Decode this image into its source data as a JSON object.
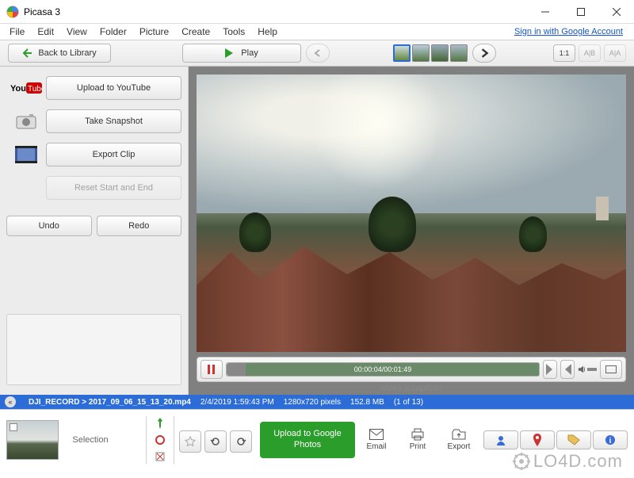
{
  "window": {
    "title": "Picasa 3"
  },
  "menu": {
    "items": [
      "File",
      "Edit",
      "View",
      "Folder",
      "Picture",
      "Create",
      "Tools",
      "Help"
    ],
    "signin": "Sign in with Google Account"
  },
  "toolbar": {
    "back": "Back to Library",
    "play": "Play",
    "zoom_fit": "1:1",
    "zoom_ab": "A|B",
    "zoom_aa": "A|A"
  },
  "sidebar": {
    "youtube": "Upload to YouTube",
    "snapshot": "Take Snapshot",
    "export": "Export Clip",
    "reset": "Reset Start and End",
    "undo": "Undo",
    "redo": "Redo"
  },
  "playback": {
    "time": "00:00:04/00:01:49"
  },
  "caption": {
    "placeholder": "Make a caption!"
  },
  "infobar": {
    "path": "DJI_RECORD > 2017_09_06_15_13_20.mp4",
    "date": "2/4/2019 1:59:43 PM",
    "dims": "1280x720 pixels",
    "size": "152.8 MB",
    "pos": "(1 of 13)"
  },
  "bottom": {
    "selection": "Selection",
    "upload": "Upload to Google Photos",
    "email": "Email",
    "print": "Print",
    "export": "Export"
  },
  "watermark": "LO4D.com"
}
